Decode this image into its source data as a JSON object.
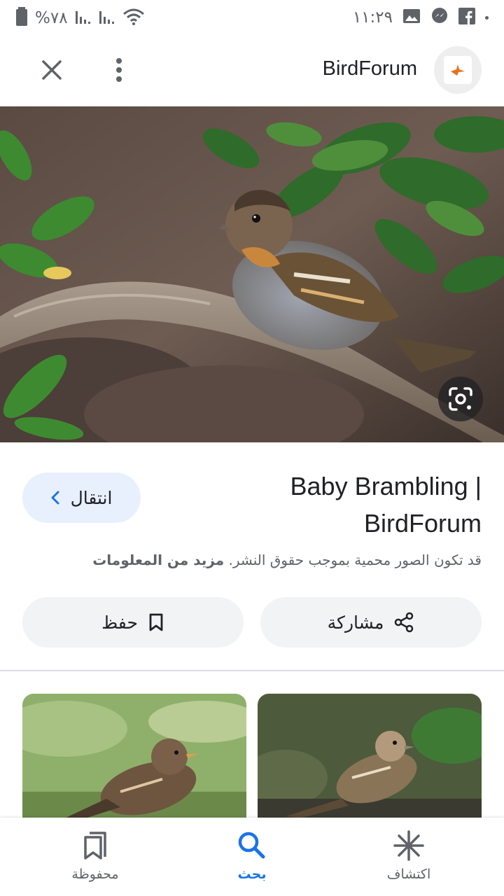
{
  "status_bar": {
    "battery_percent": "%٧٨",
    "time": "١١:٢٩",
    "icons": [
      "battery-icon",
      "signal-icon",
      "signal-icon",
      "wifi-icon",
      "facebook-icon",
      "messenger-icon",
      "gallery-icon"
    ]
  },
  "header": {
    "site_name": "BirdForum"
  },
  "result": {
    "title": "Baby Brambling | BirdForum",
    "visit_label": "انتقال",
    "copyright_text": "قد تكون الصور محمية بموجب حقوق النشر.",
    "learn_more": "مزيد من المعلومات"
  },
  "actions": {
    "share_label": "مشاركة",
    "save_label": "حفظ"
  },
  "bottom_nav": {
    "discover_label": "اكتشاف",
    "search_label": "بحث",
    "saved_label": "محفوظة",
    "active": "search"
  },
  "colors": {
    "accent": "#1a73e8",
    "visit_bg": "#e8f0fe",
    "chip_bg": "#f1f3f4"
  }
}
